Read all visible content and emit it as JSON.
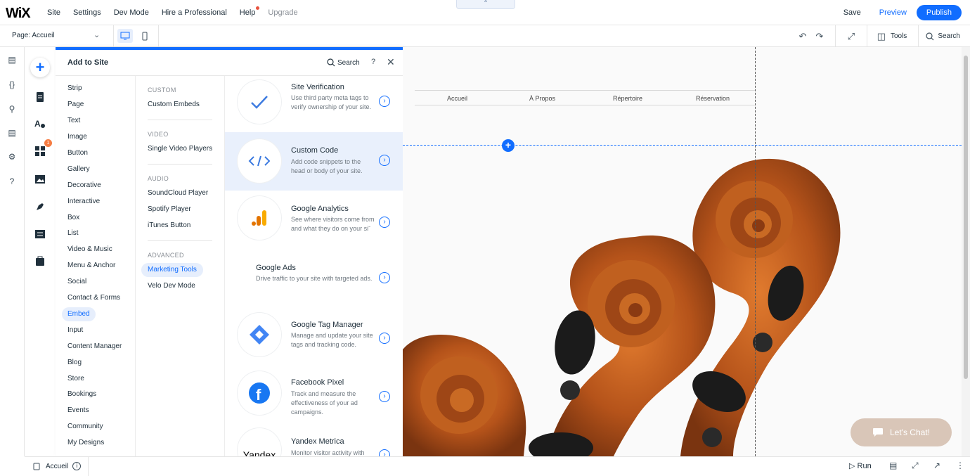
{
  "topbar": {
    "logo": "WiX",
    "menu": [
      "Site",
      "Settings",
      "Dev Mode",
      "Hire a Professional",
      "Help",
      "Upgrade"
    ],
    "collapse_icon": "chevron-up",
    "save": "Save",
    "preview": "Preview",
    "publish": "Publish"
  },
  "subbar": {
    "page": "Page: Accueil",
    "tools": "Tools",
    "search": "Search"
  },
  "panel": {
    "title": "Add to Site",
    "search": "Search",
    "help": "?",
    "categories": [
      "Strip",
      "Page",
      "Text",
      "Image",
      "Button",
      "Gallery",
      "Decorative",
      "Interactive",
      "Box",
      "List",
      "Video & Music",
      "Menu & Anchor",
      "Social",
      "Contact & Forms",
      "Embed",
      "Input",
      "Content Manager",
      "Blog",
      "Store",
      "Bookings",
      "Events",
      "Community",
      "My Designs"
    ],
    "selected_category": "Embed",
    "sections": {
      "custom": {
        "label": "CUSTOM",
        "items": [
          "Custom Embeds"
        ]
      },
      "video": {
        "label": "VIDEO",
        "items": [
          "Single Video Players"
        ]
      },
      "audio": {
        "label": "AUDIO",
        "items": [
          "SoundCloud Player",
          "Spotify Player",
          "iTunes Button"
        ]
      },
      "advanced": {
        "label": "ADVANCED",
        "items": [
          "Marketing Tools",
          "Velo Dev Mode"
        ]
      }
    },
    "selected_sub": "Marketing Tools",
    "cards": [
      {
        "title": "Site Verification",
        "desc": "Use third party meta tags to verify ownership of your site."
      },
      {
        "title": "Custom Code",
        "desc": "Add code snippets to the head or body of your site."
      },
      {
        "title": "Google Analytics",
        "desc": "See where visitors come from and what they do on your siˉ"
      },
      {
        "title": "Google Ads",
        "desc": "Drive traffic to your site with targeted ads."
      },
      {
        "title": "Google Tag Manager",
        "desc": "Manage and update your site tags and tracking code."
      },
      {
        "title": "Facebook Pixel",
        "desc": "Track and measure the effectiveness of your ad campaigns."
      },
      {
        "title": "Yandex Metrica",
        "desc": "Monitor visitor activity with"
      }
    ],
    "yandex_logo": "Yandex"
  },
  "canvas": {
    "nav": [
      "Accueil",
      "À Propos",
      "Répertoire",
      "Réservation"
    ],
    "chat": "Let's Chat!"
  },
  "bottombar": {
    "page": "Accueil",
    "run": "Run"
  },
  "badge_count": "1",
  "colors": {
    "accent": "#116dff",
    "selected_bg": "#e6eefc",
    "chat": "#d9c6b8"
  }
}
